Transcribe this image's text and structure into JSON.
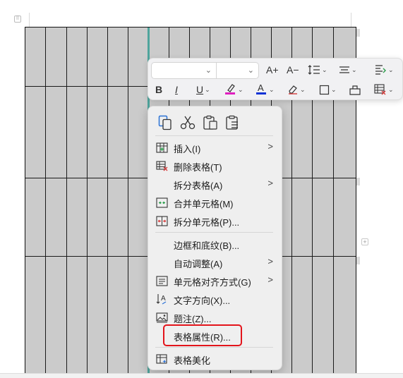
{
  "toolbar": {
    "font_name_value": "",
    "font_size_value": "",
    "grow_font": "A+",
    "shrink_font": "A−",
    "bold": "B",
    "italic": "I",
    "underline": "U",
    "highlight_color": "#e01fbf",
    "font_color": "#1033d6",
    "dropdown_chevron": "⌄"
  },
  "menu": {
    "items": [
      {
        "label": "插入(I)",
        "icon": "table-insert-icon",
        "has_submenu": true
      },
      {
        "label": "删除表格(T)",
        "icon": "table-delete-icon",
        "has_submenu": false
      },
      {
        "label": "拆分表格(A)",
        "icon": "",
        "has_submenu": true
      },
      {
        "label": "合并单元格(M)",
        "icon": "merge-cells-icon",
        "has_submenu": false
      },
      {
        "label": "拆分单元格(P)...",
        "icon": "split-cells-icon",
        "has_submenu": false
      },
      {
        "label": "边框和底纹(B)...",
        "icon": "",
        "has_submenu": false
      },
      {
        "label": "自动调整(A)",
        "icon": "",
        "has_submenu": true
      },
      {
        "label": "单元格对齐方式(G)",
        "icon": "cell-align-icon",
        "has_submenu": true
      },
      {
        "label": "文字方向(X)...",
        "icon": "text-direction-icon",
        "has_submenu": false
      },
      {
        "label": "题注(Z)...",
        "icon": "caption-icon",
        "has_submenu": false
      },
      {
        "label": "表格属性(R)...",
        "icon": "",
        "has_submenu": false
      },
      {
        "label": "表格美化",
        "icon": "table-beautify-icon",
        "has_submenu": false
      }
    ],
    "submenu_arrow": ">"
  },
  "page": {
    "add_row_symbol": "+",
    "corner_mark": "⠿"
  },
  "colors": {
    "table_fill": "#cbcbcb",
    "selection_line": "#4fa59d",
    "highlight_box": "#e3141b",
    "menu_bg": "#efefef"
  }
}
